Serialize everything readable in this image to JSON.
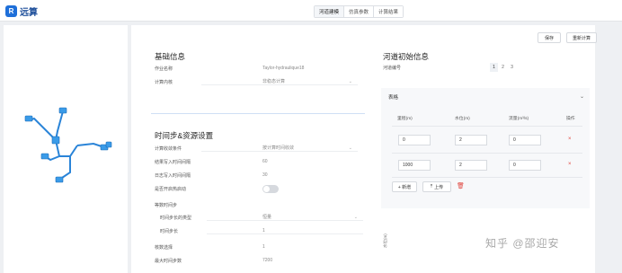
{
  "app": {
    "logo_mark": "R",
    "name": "远算"
  },
  "top_tabs": [
    {
      "label": "河道建模",
      "active": true
    },
    {
      "label": "仿真参数",
      "active": false
    },
    {
      "label": "计算结果",
      "active": false
    }
  ],
  "toolbar": {
    "save_label": "保存",
    "recalc_label": "重新计算"
  },
  "basic_info": {
    "title": "基础信息",
    "job_name_label": "作业名称",
    "job_name_value": "Taylor-hydraulique18",
    "calc_core_label": "计算内核",
    "calc_core_value": "非稳态计算"
  },
  "time_resources": {
    "title": "时间步&资源设置",
    "convergence_label": "计算收敛条件",
    "convergence_value": "按计算时间收敛",
    "result_interval_label": "结果写入时间间隔",
    "result_interval_value": "60",
    "log_interval_label": "日志写入时间间隔",
    "log_interval_value": "30",
    "hotstart_label": "是否开启热启动",
    "hotstart_on": false,
    "sync_label": "等数时间步",
    "step_type_label": "时间步长的类型",
    "step_type_value": "恒量",
    "step_label": "时间步长",
    "step_value": "1",
    "cores_label": "核数选择",
    "cores_value": "1",
    "max_iter_label": "最大时间步数",
    "max_iter_value": "7200"
  },
  "river_init": {
    "title": "河道初始信息",
    "river_id_label": "河道编号",
    "pages": [
      "1",
      "2",
      "3"
    ],
    "active_page": "1",
    "collapse_label": "表格",
    "columns": [
      "里程(m)",
      "水位(m)",
      "流量(m³/s)",
      "操作"
    ],
    "rows": [
      {
        "mileage": "0",
        "level": "2",
        "flow": "0"
      },
      {
        "mileage": "1000",
        "level": "2",
        "flow": "0"
      }
    ],
    "add_label": "+ 新增",
    "upload_label": "上传",
    "chart_axis_label": "水位(m)"
  },
  "watermark": "知乎 @邵迎安",
  "colors": {
    "accent": "#1e6fd9",
    "danger": "#e0463f"
  }
}
